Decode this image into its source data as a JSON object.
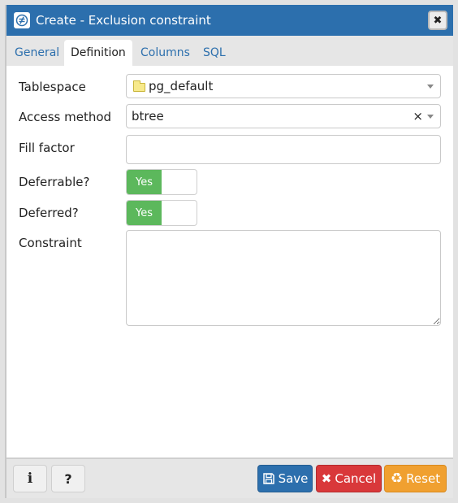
{
  "window": {
    "title": "Create - Exclusion constraint",
    "close_label": "✖"
  },
  "tabs": [
    {
      "label": "General",
      "active": false
    },
    {
      "label": "Definition",
      "active": true
    },
    {
      "label": "Columns",
      "active": false
    },
    {
      "label": "SQL",
      "active": false
    }
  ],
  "form": {
    "tablespace": {
      "label": "Tablespace",
      "value": "pg_default"
    },
    "access_method": {
      "label": "Access method",
      "value": "btree",
      "clear": "×"
    },
    "fill_factor": {
      "label": "Fill factor",
      "value": ""
    },
    "deferrable": {
      "label": "Deferrable?",
      "value": "Yes"
    },
    "deferred": {
      "label": "Deferred?",
      "value": "Yes"
    },
    "constraint": {
      "label": "Constraint",
      "value": ""
    }
  },
  "footer": {
    "info_label": "i",
    "help_label": "?",
    "save_label": "Save",
    "cancel_label": "Cancel",
    "reset_label": "Reset"
  },
  "colors": {
    "titlebar": "#2c6fad",
    "toggle_on": "#5cb85c",
    "save": "#2c6fad",
    "cancel": "#d9383a",
    "reset": "#f0a030"
  }
}
